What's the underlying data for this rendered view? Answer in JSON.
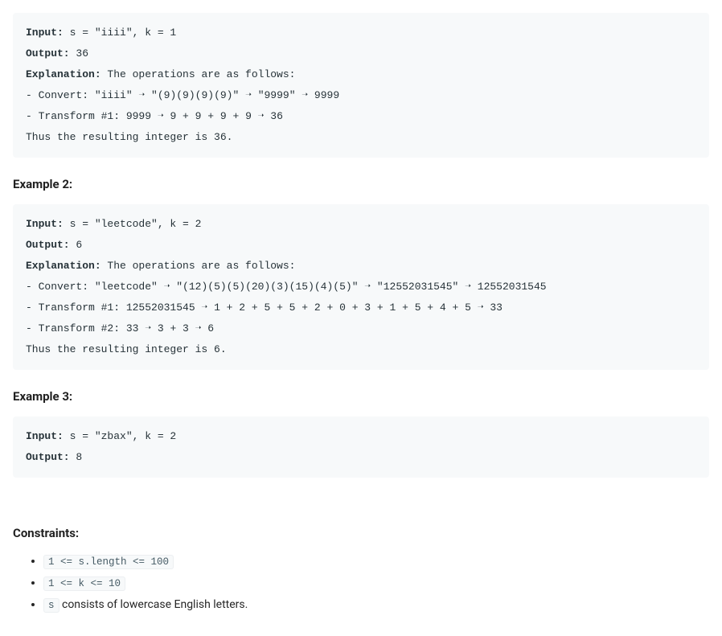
{
  "example1": {
    "inputLabel": "Input:",
    "inputValue": " s = \"iiii\", k = 1",
    "outputLabel": "Output:",
    "outputValue": " 36",
    "explanationLabel": "Explanation:",
    "explanationValue": " The operations are as follows:",
    "line_convert": "- Convert: \"iiii\" ➝ \"(9)(9)(9)(9)\" ➝ \"9999\" ➝ 9999",
    "line_t1": "- Transform #1: 9999 ➝ 9 + 9 + 9 + 9 ➝ 36",
    "line_result": "Thus the resulting integer is 36."
  },
  "headingExample2": "Example 2:",
  "example2": {
    "inputLabel": "Input:",
    "inputValue": " s = \"leetcode\", k = 2",
    "outputLabel": "Output:",
    "outputValue": " 6",
    "explanationLabel": "Explanation:",
    "explanationValue": " The operations are as follows:",
    "line_convert": "- Convert: \"leetcode\" ➝ \"(12)(5)(5)(20)(3)(15)(4)(5)\" ➝ \"12552031545\" ➝ 12552031545",
    "line_t1": "- Transform #1: 12552031545 ➝ 1 + 2 + 5 + 5 + 2 + 0 + 3 + 1 + 5 + 4 + 5 ➝ 33",
    "line_t2": "- Transform #2: 33 ➝ 3 + 3 ➝ 6",
    "line_result": "Thus the resulting integer is 6."
  },
  "headingExample3": "Example 3:",
  "example3": {
    "inputLabel": "Input:",
    "inputValue": " s = \"zbax\", k = 2",
    "outputLabel": "Output:",
    "outputValue": " 8"
  },
  "headingConstraints": "Constraints:",
  "constraints": {
    "c1": "1 <= s.length <= 100",
    "c2": "1 <= k <= 10",
    "c3_code": "s",
    "c3_text": " consists of lowercase English letters."
  }
}
